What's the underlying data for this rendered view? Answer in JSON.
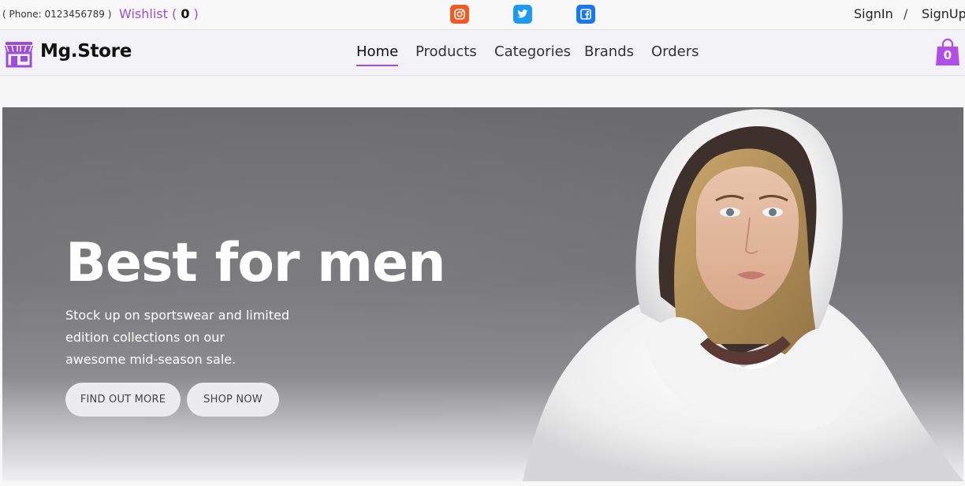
{
  "topbar": {
    "phone": "( Phone: 0123456789 )",
    "wishlist_label": "Wishlist (",
    "wishlist_count": "0",
    "wishlist_close": ")",
    "social": [
      "instagram-icon",
      "twitter-icon",
      "facebook-icon"
    ],
    "signin": "SignIn",
    "separator": "/",
    "signup": "SignUp"
  },
  "navbar": {
    "brand": "Mg.Store",
    "items": [
      {
        "label": "Home",
        "active": true
      },
      {
        "label": "Products"
      },
      {
        "label": "Categories"
      },
      {
        "label": "Brands"
      },
      {
        "label": "Orders"
      }
    ],
    "cart_count": "0"
  },
  "hero": {
    "title": "Best for men",
    "text_line1": "Stock up on sportswear and limited",
    "text_line2": "edition collections on our",
    "text_line3": "awesome mid-season sale.",
    "button_find": "FIND OUT MORE",
    "button_shop": "SHOP NOW"
  },
  "colors": {
    "accent": "#9b4dd8",
    "instagram": "#f15a24",
    "twitter": "#1d9bf0",
    "facebook": "#1877f2"
  }
}
